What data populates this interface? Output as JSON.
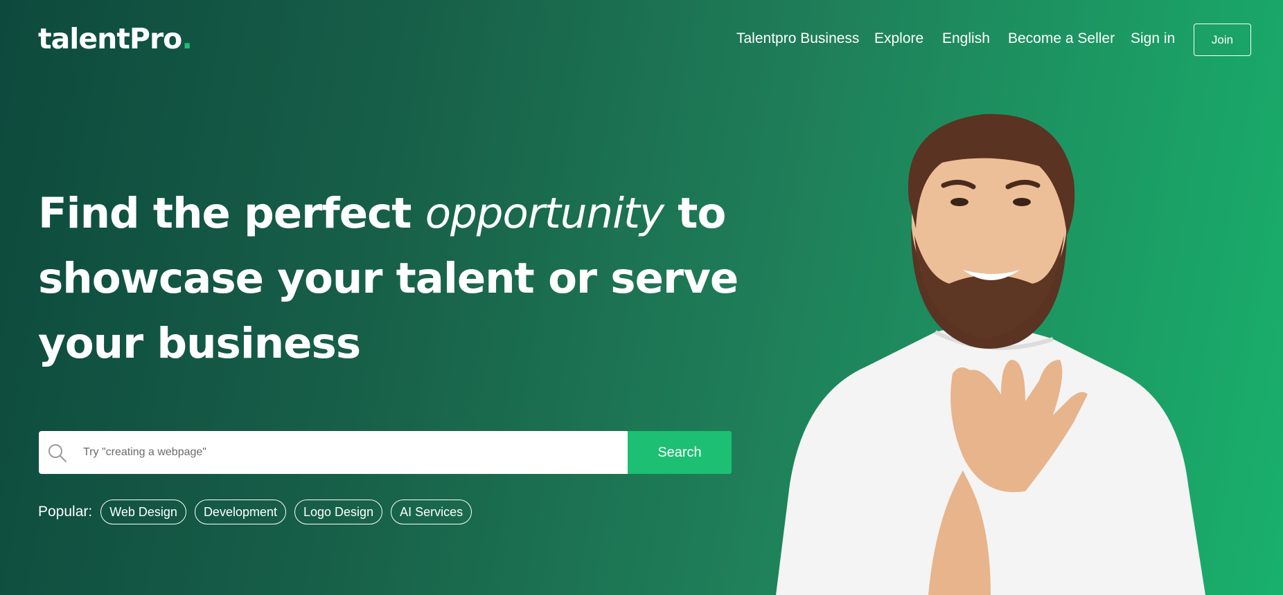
{
  "header": {
    "logo_text": "talentPro",
    "logo_dot": ".",
    "nav": [
      {
        "label": "Talentpro Business"
      },
      {
        "label": "Explore"
      },
      {
        "label": "English"
      },
      {
        "label": "Become a Seller"
      },
      {
        "label": "Sign in"
      }
    ],
    "join_label": "Join"
  },
  "hero": {
    "headline_part1": "Find the perfect ",
    "headline_em": "opportunity",
    "headline_part2": " to showcase your talent or serve your business",
    "search_placeholder": "Try \"creating a webpage\"",
    "search_button": "Search",
    "popular_label": "Popular:",
    "popular_tags": [
      "Web Design",
      "Development",
      "Logo Design",
      "AI Services"
    ],
    "image_icon": "smiling-man-photo"
  },
  "colors": {
    "accent": "#1dbf73",
    "bg_dark": "#0d4a3d",
    "bg_light": "#19b06c"
  }
}
